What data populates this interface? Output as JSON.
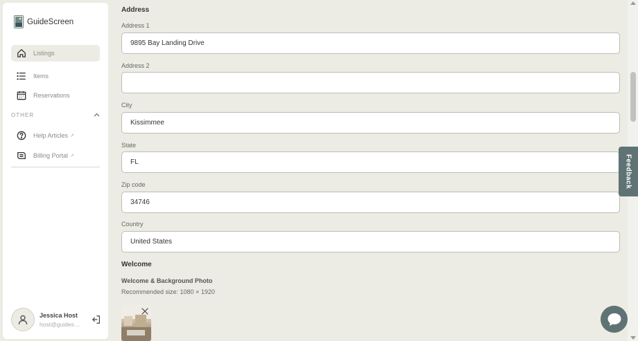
{
  "app": {
    "name": "GuideScreen"
  },
  "sidebar": {
    "items": [
      {
        "label": "Listings",
        "icon": "home-icon",
        "active": true
      },
      {
        "label": "Items",
        "icon": "list-icon",
        "active": false
      },
      {
        "label": "Reservations",
        "icon": "calendar-icon",
        "active": false
      }
    ],
    "other_label": "OTHER",
    "other_items": [
      {
        "label": "Help Articles",
        "icon": "help-circle-icon",
        "external": "↗"
      },
      {
        "label": "Billing Portal",
        "icon": "billing-icon",
        "external": "↗"
      }
    ],
    "user": {
      "name": "Jessica Host",
      "email": "host@guidescreen.com"
    }
  },
  "address": {
    "section_title": "Address",
    "address1": {
      "label": "Address 1",
      "value": "9895 Bay Landing Drive"
    },
    "address2": {
      "label": "Address 2",
      "value": ""
    },
    "city": {
      "label": "City",
      "value": "Kissimmee"
    },
    "state": {
      "label": "State",
      "value": "FL"
    },
    "zip": {
      "label": "Zip code",
      "value": "34746"
    },
    "country": {
      "label": "Country",
      "value": "United States"
    }
  },
  "welcome": {
    "section_title": "Welcome",
    "photo_label": "Welcome & Background Photo",
    "recommended": "Recommended size: 1080 × 1920"
  },
  "feedback": {
    "label": "Feedback"
  },
  "colors": {
    "accent": "#5f7374",
    "background": "#ecece4"
  }
}
